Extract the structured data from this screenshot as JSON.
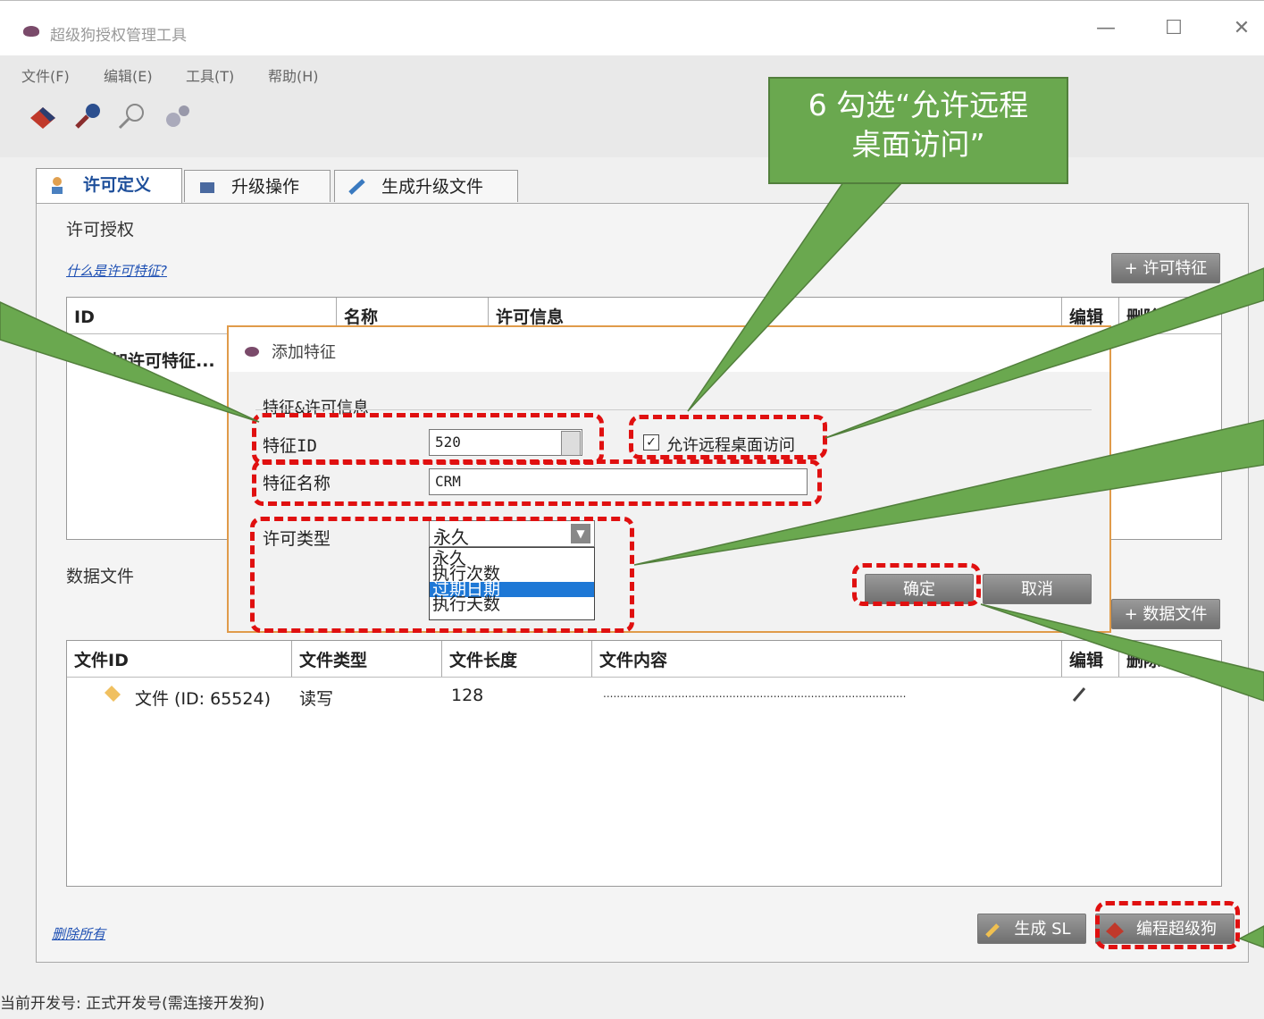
{
  "window": {
    "title": "超级狗授权管理工具",
    "minimize": "—",
    "maximize": "☐",
    "close": "✕"
  },
  "menu": [
    "文件(F)",
    "编辑(E)",
    "工具(T)",
    "帮助(H)"
  ],
  "tabs": [
    "许可定义",
    "升级操作",
    "生成升级文件"
  ],
  "license_section": {
    "title": "许可授权",
    "link": "什么是许可特征?",
    "add_button": "+ 许可特征",
    "columns": [
      "ID",
      "名称",
      "许可信息",
      "编辑",
      "删除"
    ],
    "add_row": "添加许可特征..."
  },
  "data_section": {
    "title": "数据文件",
    "add_button": "+ 数据文件",
    "columns": [
      "文件ID",
      "文件类型",
      "文件长度",
      "文件内容",
      "编辑",
      "删除"
    ],
    "rows": [
      {
        "id": "文件 (ID: 65524)",
        "type": "读写",
        "length": "128",
        "content": "........................................................................................."
      }
    ]
  },
  "footer": {
    "delete_all": "删除所有",
    "generate_button": "生成 SL",
    "program_button": "编程超级狗"
  },
  "status": "当前开发号: 正式开发号(需连接开发狗)",
  "dialog": {
    "title": "添加特征",
    "group": "特征&许可信息",
    "feature_id_label": "特征ID",
    "feature_id_value": "520",
    "remote_label": "允许远程桌面访问",
    "remote_checked": true,
    "feature_name_label": "特征名称",
    "feature_name_value": "CRM",
    "license_type_label": "许可类型",
    "license_type_value": "永久",
    "license_options": [
      "永久",
      "执行次数",
      "过期日期",
      "执行天数"
    ],
    "selected_option": "过期日期",
    "ok": "确定",
    "cancel": "取消"
  },
  "annotation": {
    "text_line1": "6 勾选“允许远程",
    "text_line2": "桌面访问”"
  },
  "colors": {
    "accent_red": "#e01010",
    "callout_green": "#6aa84f",
    "dialog_border": "#e09b4a",
    "selection": "#1e78d6"
  }
}
